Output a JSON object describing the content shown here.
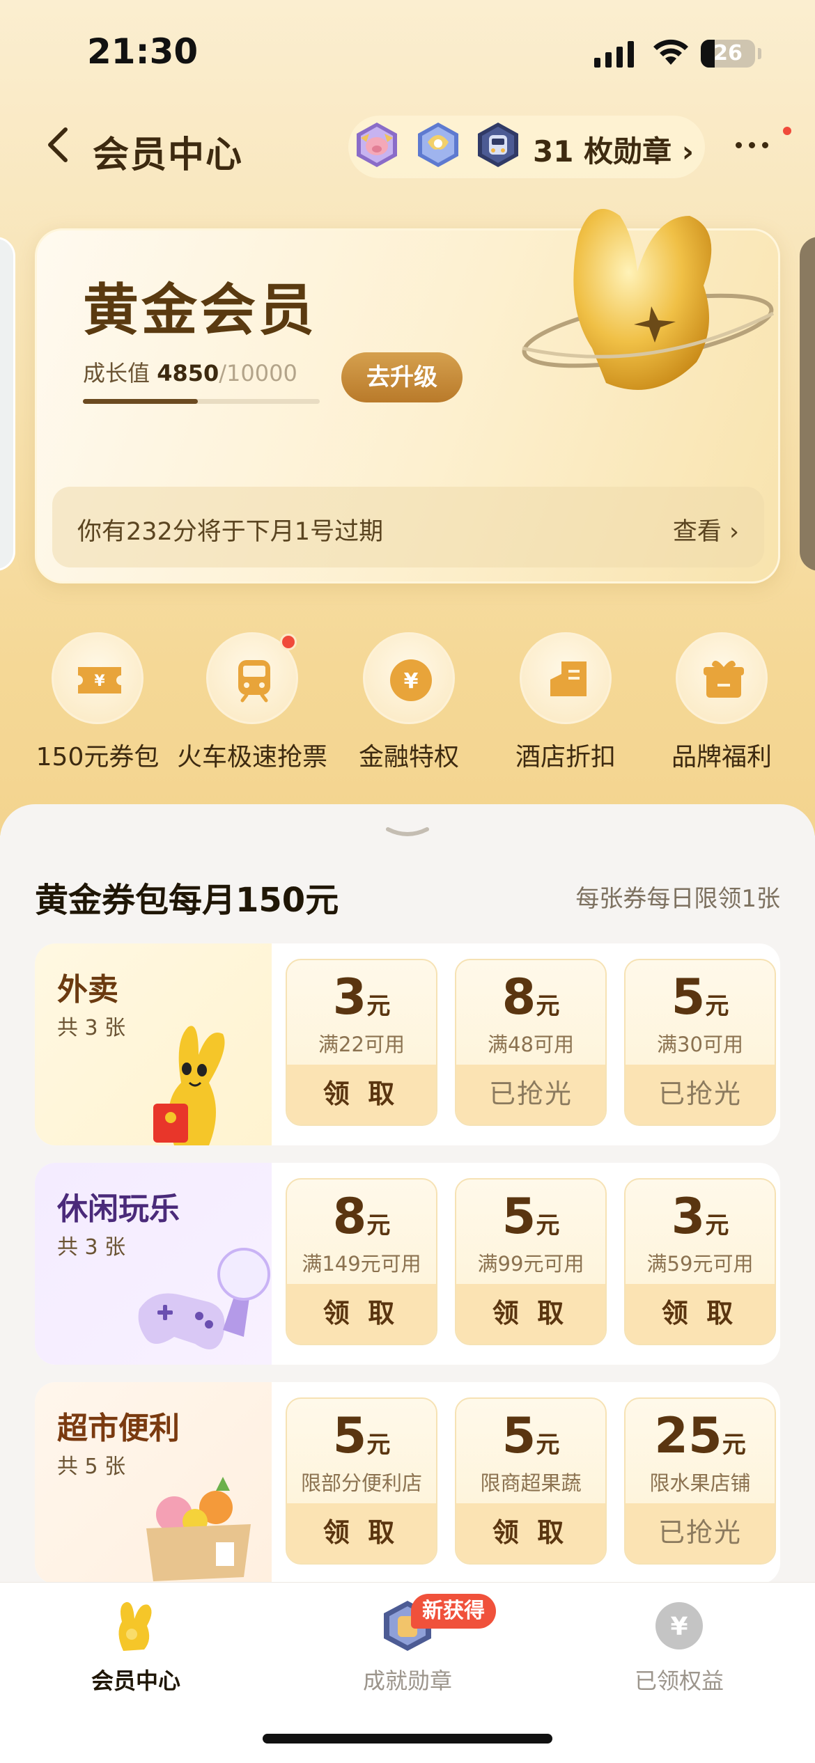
{
  "status_bar": {
    "time": "21:30",
    "battery": "26",
    "battery_level": 0.26
  },
  "nav": {
    "title": "会员中心",
    "badge_count_text": "31 枚勋章 ›",
    "icons": [
      "back-chevron-icon",
      "medal-icon",
      "more-icon"
    ]
  },
  "member_card": {
    "tier": "黄金会员",
    "growth_label": "成长值",
    "growth_value": "4850",
    "growth_total": "/10000",
    "growth_progress": 0.485,
    "upgrade_label": "去升级",
    "points_notice": "你有232分将于下月1号过期",
    "points_link": "查看 ›"
  },
  "shortcuts": [
    {
      "label": "150元券包",
      "icon": "ticket-icon"
    },
    {
      "label": "火车极速抢票",
      "icon": "train-icon"
    },
    {
      "label": "金融特权",
      "icon": "yen-coin-icon"
    },
    {
      "label": "酒店折扣",
      "icon": "hotel-icon"
    },
    {
      "label": "品牌福利",
      "icon": "gift-icon"
    }
  ],
  "coupon_section": {
    "title": "黄金券包每月150元",
    "note": "每张券每日限领1张",
    "unit": "元",
    "categories": [
      {
        "name": "外卖",
        "count": "共 3 张",
        "coupons": [
          {
            "amount": "3",
            "condition": "满22可用",
            "action": "领 取",
            "claimed": false
          },
          {
            "amount": "8",
            "condition": "满48可用",
            "action": "已抢光",
            "claimed": true
          },
          {
            "amount": "5",
            "condition": "满30可用",
            "action": "已抢光",
            "claimed": true
          }
        ]
      },
      {
        "name": "休闲玩乐",
        "count": "共 3 张",
        "coupons": [
          {
            "amount": "8",
            "condition": "满149元可用",
            "action": "领 取",
            "claimed": false
          },
          {
            "amount": "5",
            "condition": "满99元可用",
            "action": "领 取",
            "claimed": false
          },
          {
            "amount": "3",
            "condition": "满59元可用",
            "action": "领 取",
            "claimed": false
          }
        ]
      },
      {
        "name": "超市便利",
        "count": "共 5 张",
        "coupons": [
          {
            "amount": "5",
            "condition": "限部分便利店",
            "action": "领 取",
            "claimed": false
          },
          {
            "amount": "5",
            "condition": "限商超果蔬",
            "action": "领 取",
            "claimed": false
          },
          {
            "amount": "25",
            "condition": "限水果店铺",
            "action": "已抢光",
            "claimed": true
          }
        ]
      }
    ]
  },
  "tabbar": {
    "tabs": [
      {
        "label": "会员中心",
        "active": true,
        "icon": "member-bunny-icon"
      },
      {
        "label": "成就勋章",
        "active": false,
        "icon": "achievement-medal-icon"
      },
      {
        "label": "已领权益",
        "active": false,
        "icon": "yen-circle-icon"
      }
    ],
    "new_badge": "新获得"
  },
  "colors": {
    "accent": "#c68a36",
    "brand_gold": "#f5d896",
    "red_dot": "#f04a3a"
  }
}
